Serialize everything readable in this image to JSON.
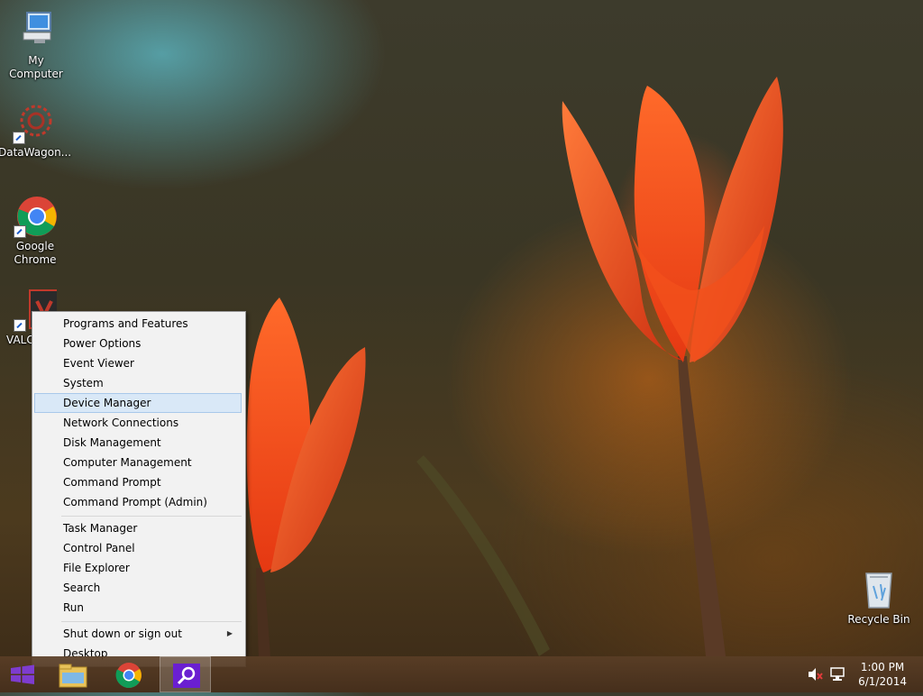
{
  "desktop": {
    "icons": [
      {
        "label": "My Computer"
      },
      {
        "label": "DataWagon..."
      },
      {
        "label": "Google Chrome"
      },
      {
        "label": "VALC"
      },
      {
        "label": "Recycle Bin"
      }
    ]
  },
  "context_menu": {
    "items": [
      {
        "label": "Programs and Features"
      },
      {
        "label": "Power Options"
      },
      {
        "label": "Event Viewer"
      },
      {
        "label": "System"
      },
      {
        "label": "Device Manager",
        "highlighted": true
      },
      {
        "label": "Network Connections"
      },
      {
        "label": "Disk Management"
      },
      {
        "label": "Computer Management"
      },
      {
        "label": "Command Prompt"
      },
      {
        "label": "Command Prompt (Admin)"
      },
      {
        "label": "Task Manager"
      },
      {
        "label": "Control Panel"
      },
      {
        "label": "File Explorer"
      },
      {
        "label": "Search"
      },
      {
        "label": "Run"
      },
      {
        "label": "Shut down or sign out",
        "has_submenu": true
      },
      {
        "label": "Desktop"
      }
    ]
  },
  "taskbar": {
    "buttons": [
      {
        "icon": "windows-start-icon"
      },
      {
        "icon": "file-explorer-icon"
      },
      {
        "icon": "chrome-icon"
      },
      {
        "icon": "search-magnifier-icon",
        "active": true
      }
    ],
    "tray": {
      "volume_icon": "speaker-muted-icon",
      "network_icon": "network-icon",
      "time": "1:00 PM",
      "date": "6/1/2014"
    }
  },
  "colors": {
    "menu_bg": "#f2f2f2",
    "menu_highlight": "#d9e8f7",
    "start_button": "#7e3ccf",
    "search_tile": "#6a1fd1"
  }
}
